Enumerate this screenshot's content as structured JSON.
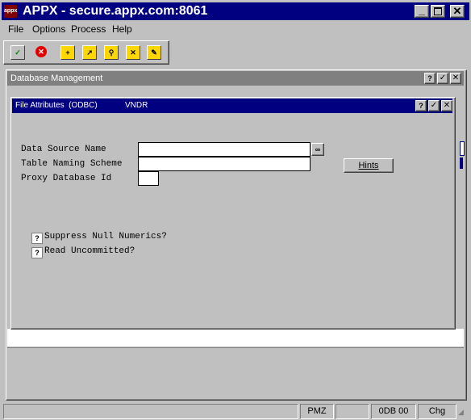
{
  "window": {
    "title": "APPX - secure.appx.com:8061",
    "icon_text": "appx"
  },
  "menu": [
    "File",
    "Options",
    "Process",
    "Help"
  ],
  "toolbar": [
    "check-icon",
    "stop-icon",
    "new-folder-icon",
    "open-folder-icon",
    "search-folder-icon",
    "delete-folder-icon",
    "edit-folder-icon"
  ],
  "db_window": {
    "title": "Database Management"
  },
  "dialog": {
    "title": "File Attributes  (ODBC)",
    "record": "VNDR",
    "labels": {
      "dsn": "Data Source Name",
      "naming": "Table Naming Scheme",
      "proxy": "Proxy Database Id",
      "suppress": "Suppress Null Numerics?",
      "uncommitted": "Read Uncommitted?"
    },
    "values": {
      "dsn": "",
      "naming": "",
      "proxy": "",
      "suppress": "?",
      "uncommitted": "?"
    },
    "hints_label": "Hints"
  },
  "status": [
    "",
    "PMZ",
    "",
    "0DB 00",
    "Chg"
  ]
}
